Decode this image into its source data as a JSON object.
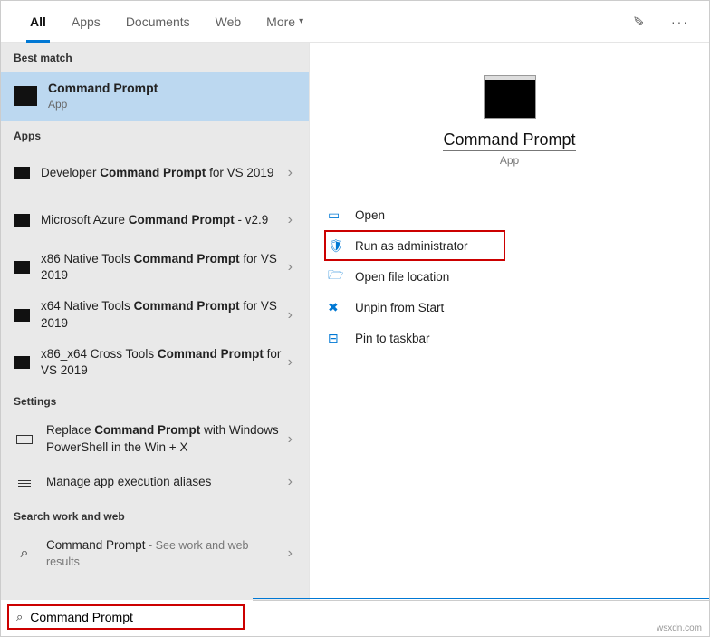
{
  "tabs": {
    "all": "All",
    "apps": "Apps",
    "documents": "Documents",
    "web": "Web",
    "more": "More"
  },
  "sections": {
    "best_match": "Best match",
    "apps": "Apps",
    "settings": "Settings",
    "search_web": "Search work and web"
  },
  "best_match": {
    "title": "Command Prompt",
    "subtitle": "App"
  },
  "apps_list": [
    {
      "pre": "Developer ",
      "bold": "Command Prompt",
      "post": " for VS 2019"
    },
    {
      "pre": "Microsoft Azure ",
      "bold": "Command Prompt",
      "post": " - v2.9"
    },
    {
      "pre": "x86 Native Tools ",
      "bold": "Command Prompt",
      "post": " for VS 2019"
    },
    {
      "pre": "x64 Native Tools ",
      "bold": "Command Prompt",
      "post": " for VS 2019"
    },
    {
      "pre": "x86_x64 Cross Tools ",
      "bold": "Command Prompt",
      "post": " for VS 2019"
    }
  ],
  "settings_list": [
    {
      "pre": "Replace ",
      "bold": "Command Prompt",
      "post": " with Windows PowerShell in the Win + X"
    },
    {
      "pre": "",
      "bold": "",
      "post": "Manage app execution aliases"
    }
  ],
  "web_list": {
    "label_pre": "Command Prompt",
    "label_post": " - See work and web results"
  },
  "detail": {
    "title": "Command Prompt",
    "subtitle": "App"
  },
  "actions": {
    "open": "Open",
    "run_admin": "Run as administrator",
    "open_loc": "Open file location",
    "unpin_start": "Unpin from Start",
    "pin_taskbar": "Pin to taskbar"
  },
  "search": {
    "value": "Command Prompt"
  },
  "watermark": "wsxdn.com"
}
